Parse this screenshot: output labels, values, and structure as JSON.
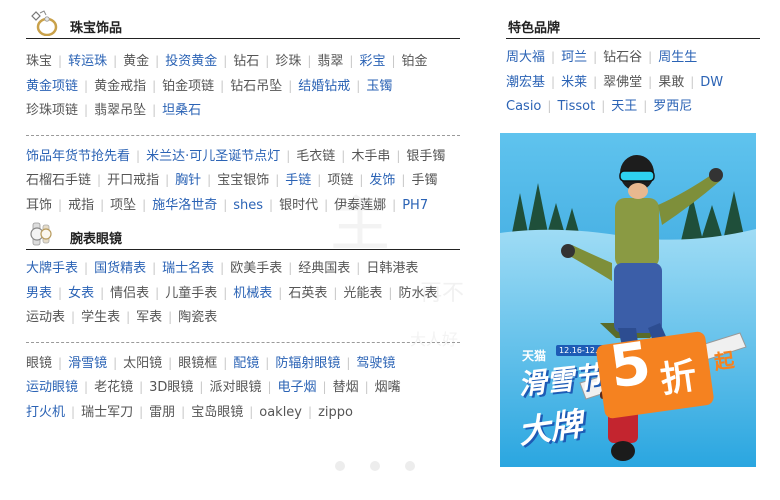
{
  "jewelry": {
    "title": "珠宝饰品",
    "rows1": [
      [
        {
          "t": "珠宝",
          "h": false
        },
        {
          "t": "转运珠",
          "h": true
        },
        {
          "t": "黄金",
          "h": false
        },
        {
          "t": "投资黄金",
          "h": true
        },
        {
          "t": "钻石",
          "h": false
        },
        {
          "t": "珍珠",
          "h": false
        },
        {
          "t": "翡翠",
          "h": false
        },
        {
          "t": "彩宝",
          "h": true
        },
        {
          "t": "铂金",
          "h": false
        }
      ],
      [
        {
          "t": "黄金项链",
          "h": true
        },
        {
          "t": "黄金戒指",
          "h": false
        },
        {
          "t": "铂金项链",
          "h": false
        },
        {
          "t": "钻石吊坠",
          "h": false
        },
        {
          "t": "结婚钻戒",
          "h": true
        },
        {
          "t": "玉镯",
          "h": true
        }
      ],
      [
        {
          "t": "珍珠项链",
          "h": false
        },
        {
          "t": "翡翠吊坠",
          "h": false
        },
        {
          "t": "坦桑石",
          "h": true
        }
      ]
    ],
    "rows2": [
      [
        {
          "t": "饰品年货节抢先看",
          "h": true
        },
        {
          "t": "米兰达·可儿圣诞节点灯",
          "h": true
        },
        {
          "t": "毛衣链",
          "h": false
        },
        {
          "t": "木手串",
          "h": false
        },
        {
          "t": "银手镯",
          "h": false
        }
      ],
      [
        {
          "t": "石榴石手链",
          "h": false
        },
        {
          "t": "开口戒指",
          "h": false
        },
        {
          "t": "胸针",
          "h": true
        },
        {
          "t": "宝宝银饰",
          "h": false
        },
        {
          "t": "手链",
          "h": true
        },
        {
          "t": "项链",
          "h": false
        },
        {
          "t": "发饰",
          "h": true
        },
        {
          "t": "手镯",
          "h": false
        }
      ],
      [
        {
          "t": "耳饰",
          "h": false
        },
        {
          "t": "戒指",
          "h": false
        },
        {
          "t": "项坠",
          "h": false
        },
        {
          "t": "施华洛世奇",
          "h": true
        },
        {
          "t": "shes",
          "h": true
        },
        {
          "t": "银时代",
          "h": false
        },
        {
          "t": "伊泰莲娜",
          "h": false
        },
        {
          "t": "PH7",
          "h": true
        }
      ]
    ]
  },
  "watches": {
    "title": "腕表眼镜",
    "rows1": [
      [
        {
          "t": "大牌手表",
          "h": true
        },
        {
          "t": "国货精表",
          "h": true
        },
        {
          "t": "瑞士名表",
          "h": true
        },
        {
          "t": "欧美手表",
          "h": false
        },
        {
          "t": "经典国表",
          "h": false
        },
        {
          "t": "日韩港表",
          "h": false
        }
      ],
      [
        {
          "t": "男表",
          "h": true
        },
        {
          "t": "女表",
          "h": true
        },
        {
          "t": "情侣表",
          "h": false
        },
        {
          "t": "儿童手表",
          "h": false
        },
        {
          "t": "机械表",
          "h": true
        },
        {
          "t": "石英表",
          "h": false
        },
        {
          "t": "光能表",
          "h": false
        },
        {
          "t": "防水表",
          "h": false
        }
      ],
      [
        {
          "t": "运动表",
          "h": false
        },
        {
          "t": "学生表",
          "h": false
        },
        {
          "t": "军表",
          "h": false
        },
        {
          "t": "陶瓷表",
          "h": false
        }
      ]
    ],
    "rows2": [
      [
        {
          "t": "眼镜",
          "h": false
        },
        {
          "t": "滑雪镜",
          "h": true
        },
        {
          "t": "太阳镜",
          "h": false
        },
        {
          "t": "眼镜框",
          "h": false
        },
        {
          "t": "配镜",
          "h": true
        },
        {
          "t": "防辐射眼镜",
          "h": true
        },
        {
          "t": "驾驶镜",
          "h": true
        }
      ],
      [
        {
          "t": "运动眼镜",
          "h": true
        },
        {
          "t": "老花镜",
          "h": false
        },
        {
          "t": "3D眼镜",
          "h": false
        },
        {
          "t": "派对眼镜",
          "h": false
        },
        {
          "t": "电子烟",
          "h": true
        },
        {
          "t": "替烟",
          "h": false
        },
        {
          "t": "烟嘴",
          "h": false
        }
      ],
      [
        {
          "t": "打火机",
          "h": true
        },
        {
          "t": "瑞士军刀",
          "h": false
        },
        {
          "t": "雷朋",
          "h": false
        },
        {
          "t": "宝岛眼镜",
          "h": false
        },
        {
          "t": "oakley",
          "h": false
        },
        {
          "t": "zippo",
          "h": false
        }
      ]
    ]
  },
  "brands": {
    "title": "特色品牌",
    "rows": [
      [
        {
          "t": "周大福",
          "h": true
        },
        {
          "t": "珂兰",
          "h": true
        },
        {
          "t": "钻石谷",
          "h": false
        },
        {
          "t": "周生生",
          "h": true
        }
      ],
      [
        {
          "t": "潮宏基",
          "h": true
        },
        {
          "t": "米莱",
          "h": true
        },
        {
          "t": "翠佛堂",
          "h": false
        },
        {
          "t": "果敢",
          "h": false
        },
        {
          "t": "DW",
          "h": true
        }
      ],
      [
        {
          "t": "Casio",
          "h": true
        },
        {
          "t": "Tissot",
          "h": true
        },
        {
          "t": "天王",
          "h": true
        },
        {
          "t": "罗西尼",
          "h": true
        }
      ]
    ]
  },
  "banner": {
    "brand": "天猫",
    "event": "滑雪节",
    "dates": "12.16-12.18",
    "main_big": "大牌",
    "main_num": "5",
    "main_discount": "折",
    "main_suffix": "起"
  },
  "colors": {
    "link_blue": "#2b63b5",
    "text_gray": "#555555",
    "separator": "#c8c8c8",
    "orange": "#f58220"
  }
}
